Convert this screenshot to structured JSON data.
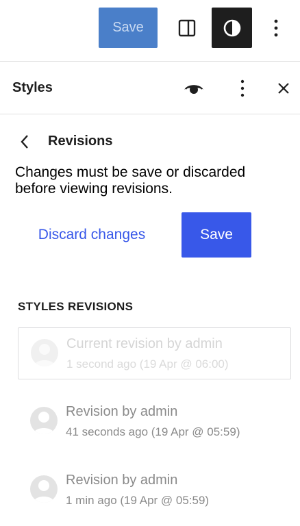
{
  "topbar": {
    "save_label": "Save"
  },
  "panel": {
    "title": "Styles"
  },
  "revisions_nav": {
    "title": "Revisions"
  },
  "notice": "Changes must be save or discarded before viewing revisions.",
  "actions": {
    "discard_label": "Discard changes",
    "save_label": "Save"
  },
  "section_heading": "STYLES REVISIONS",
  "revisions": [
    {
      "name": "Current revision by admin",
      "time": "1 second ago (19 Apr @ 06:00)"
    },
    {
      "name": "Revision by admin",
      "time": "41 seconds ago (19 Apr @ 05:59)"
    },
    {
      "name": "Revision by admin",
      "time": "1 min ago (19 Apr @ 05:59)"
    }
  ],
  "icons": {
    "sidebar": "sidebar-toggle-icon",
    "styles": "contrast-icon",
    "more": "more-vertical-icon",
    "preview": "eye-icon",
    "close": "close-icon",
    "back": "chevron-left-icon",
    "avatar": "user-avatar-icon"
  },
  "colors": {
    "accent": "#3858e9",
    "save_disabled": "#4a7fc9",
    "dark": "#1e1e1e"
  }
}
